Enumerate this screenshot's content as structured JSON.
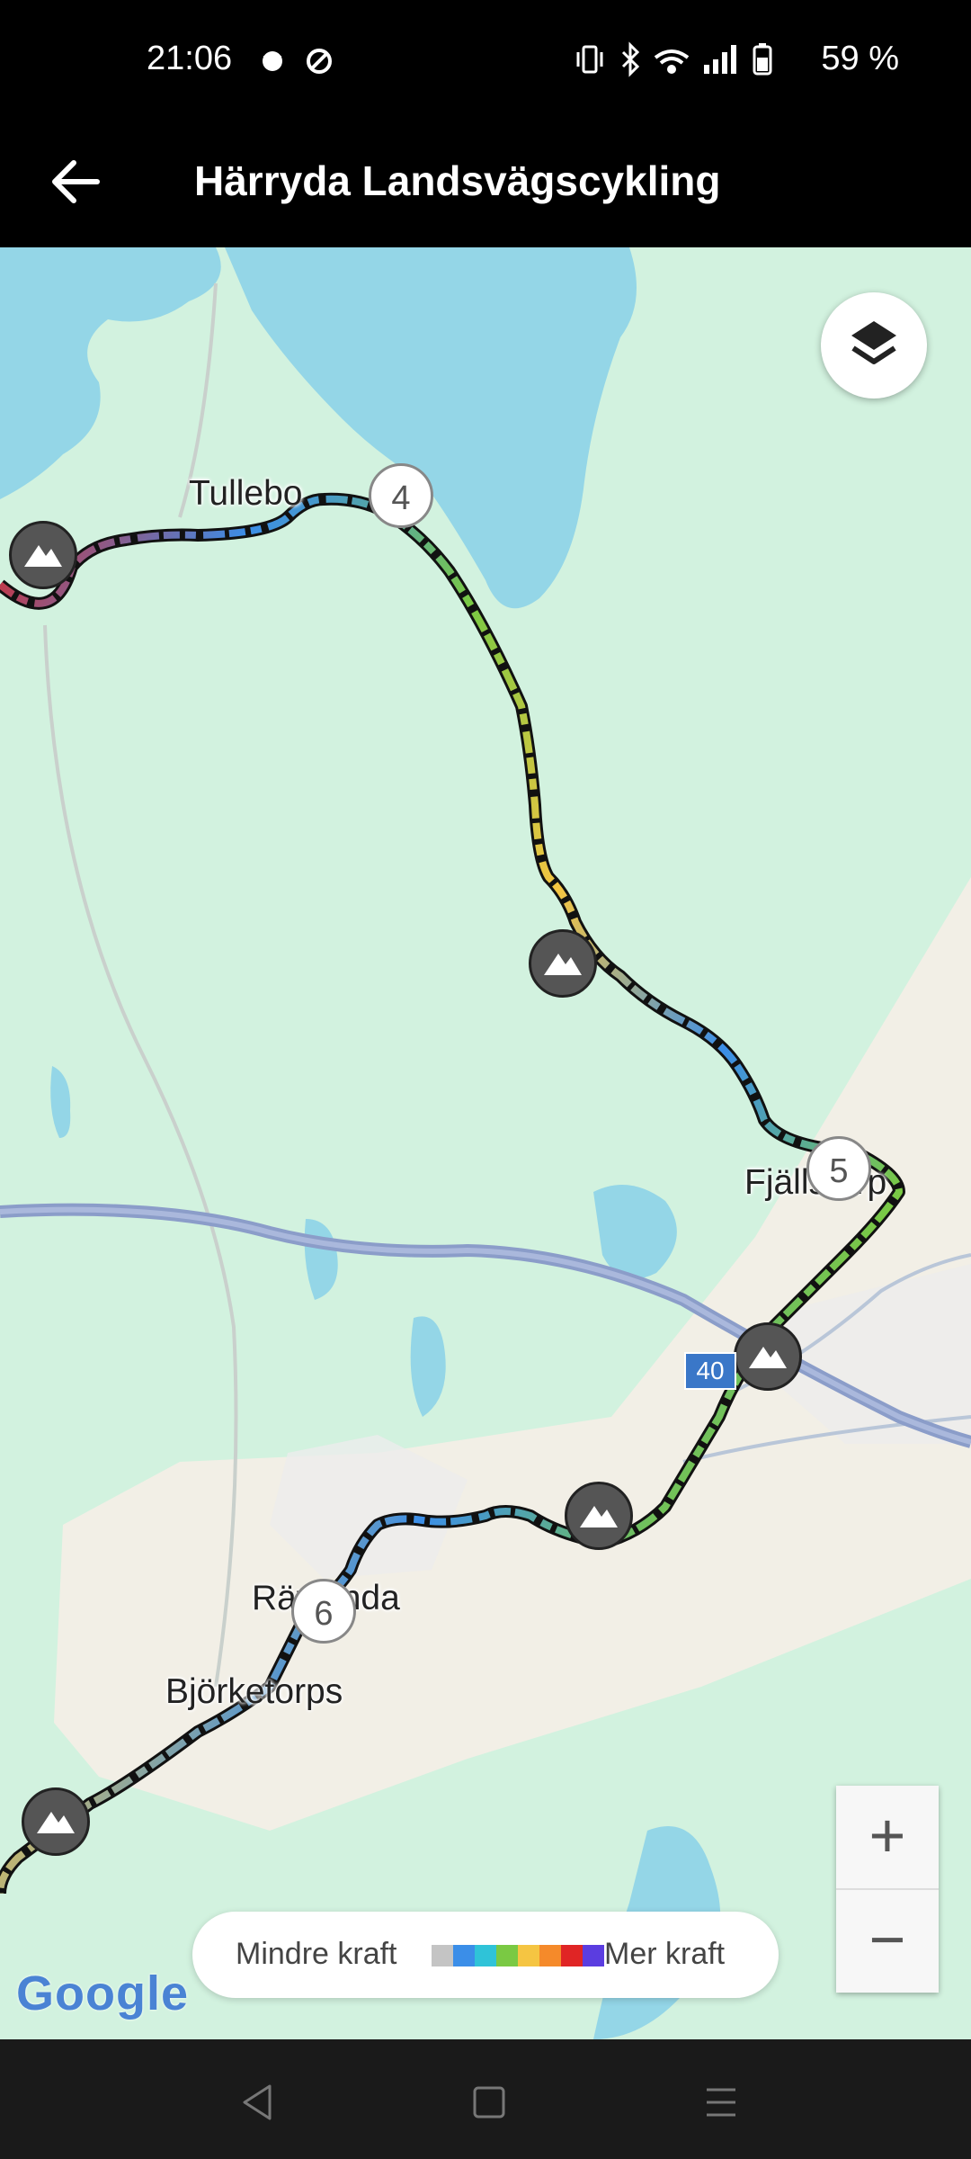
{
  "status_bar": {
    "time": "21:06",
    "battery": "59 %",
    "icons": [
      "notification-icon",
      "blocked-icon",
      "vibrate-icon",
      "bluetooth-icon",
      "wifi-icon",
      "signal-icon",
      "battery-icon"
    ]
  },
  "header": {
    "title": "Härryda Landsvägscykling",
    "back_icon": "arrow-left-icon"
  },
  "map": {
    "places": {
      "tullebo": "Tullebo",
      "fjallstorp": "Fjällstorp",
      "ravlanda": "Rävlanda",
      "bjorketorps": "Björketorps"
    },
    "waypoints": {
      "wp4": "4",
      "wp5": "5",
      "wp6": "6"
    },
    "road_number": "40",
    "attribution": "Google",
    "layers_icon": "layers-icon",
    "peak_icon": "mountain-icon"
  },
  "zoom": {
    "in_label": "+",
    "out_label": "−"
  },
  "legend": {
    "less": "Mindre kraft",
    "more": "Mer kraft",
    "scale_colors": [
      "#c4c4c4",
      "#3b8ee8",
      "#2fc3d8",
      "#7ac943",
      "#f5c542",
      "#f58a2a",
      "#e02525",
      "#5b3de0"
    ]
  },
  "navbar": {
    "items": [
      "back-nav-icon",
      "home-nav-icon",
      "menu-nav-icon"
    ]
  }
}
